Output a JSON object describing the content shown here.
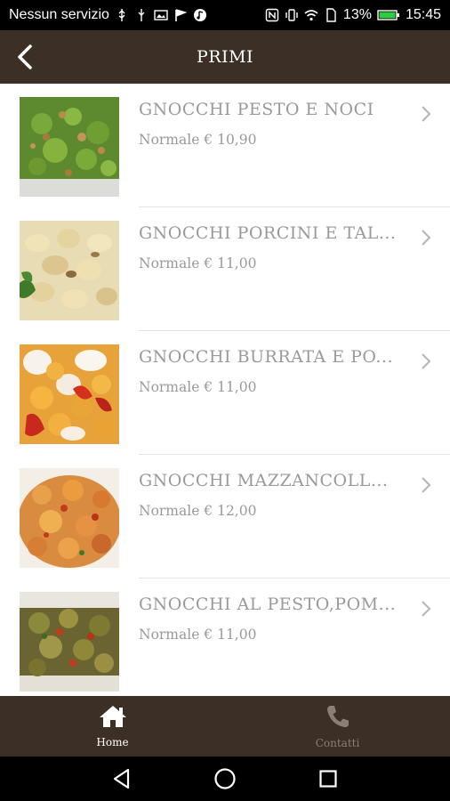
{
  "status_bar": {
    "carrier": "Nessun servizio",
    "battery": "13%",
    "time": "15:45"
  },
  "header": {
    "title": "PRIMI"
  },
  "items": [
    {
      "name": "GNOCCHI PESTO E NOCI",
      "price": "Normale € 10,90"
    },
    {
      "name": "GNOCCHI PORCINI E TAL...",
      "price": "Normale € 11,00"
    },
    {
      "name": "GNOCCHI BURRATA E PO...",
      "price": "Normale € 11,00"
    },
    {
      "name": "GNOCCHI MAZZANCOLL...",
      "price": "Normale € 12,00"
    },
    {
      "name": "GNOCCHI AL PESTO,POM...",
      "price": "Normale € 11,00"
    }
  ],
  "bottom_nav": {
    "home": "Home",
    "contatti": "Contatti"
  },
  "colors": {
    "header_bg": "#3b2f26",
    "text_muted": "#9a9a9a"
  }
}
